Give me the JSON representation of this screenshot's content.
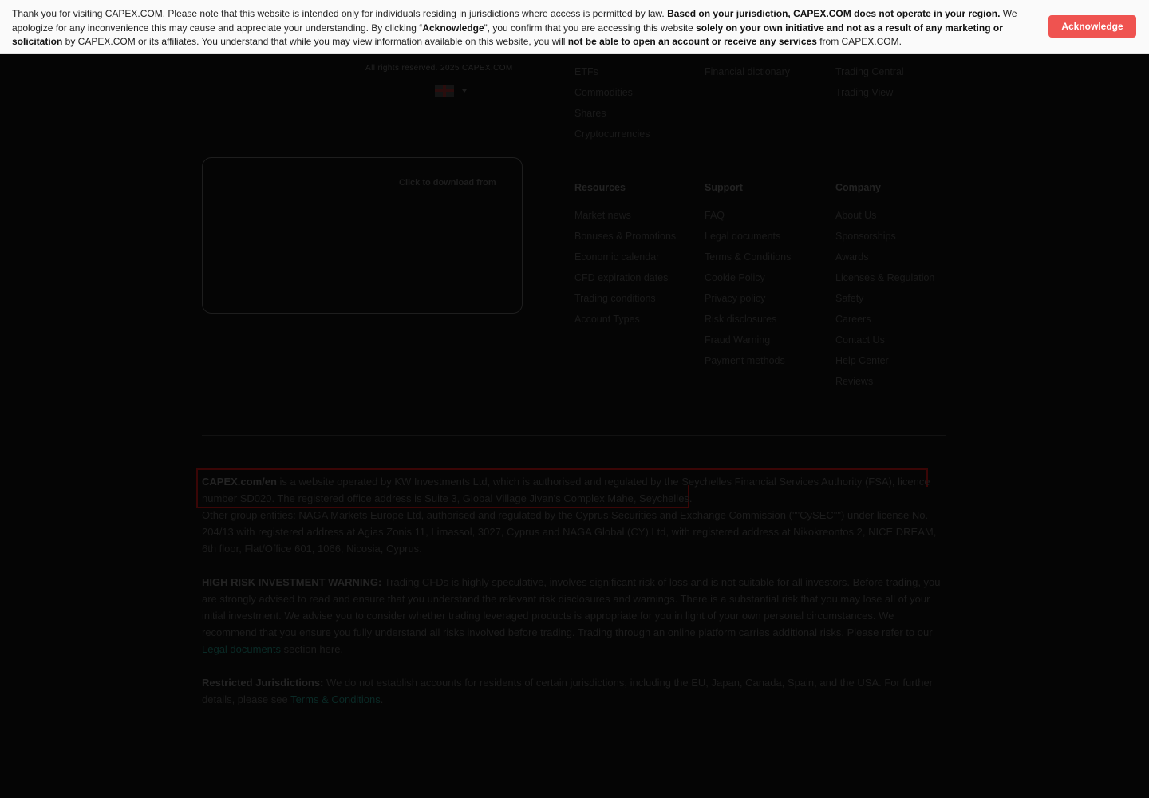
{
  "banner": {
    "p1": "Thank you for visiting CAPEX.COM. Please note that this website is intended only for individuals residing in jurisdictions where access is permitted by law. ",
    "b1": "Based on your jurisdiction, CAPEX.COM does not operate in your region.",
    "p2": " We apologize for any inconvenience this may cause and appreciate your understanding. By clicking “",
    "b2": "Acknowledge",
    "p3": "”, you confirm that you are accessing this website ",
    "b3": "solely on your own initiative and not as a result of any marketing or solicitation",
    "p4": " by CAPEX.COM or its affiliates. You understand that while you may view information available on this website, you will ",
    "b4": "not be able to open an account or receive any services",
    "p5": " from CAPEX.COM.",
    "button_label": "Acknowledge"
  },
  "footer": {
    "rights": "All rights reserved. 2025 CAPEX.COM",
    "download_label": "Click to download from",
    "markets": [
      "ETFs",
      "Commodities",
      "Shares",
      "Cryptocurrencies"
    ],
    "learn": [
      "Financial dictionary"
    ],
    "platforms": [
      "Trading Central",
      "Trading View"
    ],
    "resources": {
      "title": "Resources",
      "items": [
        "Market news",
        "Bonuses & Promotions",
        "Economic calendar",
        "CFD expiration dates",
        "Trading conditions",
        "Account Types"
      ]
    },
    "support": {
      "title": "Support",
      "items": [
        "FAQ",
        "Legal documents",
        "Terms & Conditions",
        "Cookie Policy",
        "Privacy policy",
        "Risk disclosures",
        "Fraud Warning",
        "Payment methods"
      ]
    },
    "company": {
      "title": "Company",
      "items": [
        "About Us",
        "Sponsorships",
        "Awards",
        "Licenses & Regulation",
        "Safety",
        "Careers",
        "Contact Us",
        "Help Center",
        "Reviews"
      ]
    }
  },
  "legal": {
    "site_name": "CAPEX.com/en",
    "operator_text": " is a website operated by KW Investments Ltd, which is authorised and regulated by the Seychelles Financial Services Authority (FSA), licence number SD020. The registered office address is Suite 3, Global Village Jivan's Complex Mahe, Seychelles.",
    "group_text": "Other group entities: NAGA Markets Europe Ltd, authorised and regulated by the Cyprus Securities and Exchange Commission (\"\"CySEC\"\") under license No. 204/13 with registered address at Agias Zonis 11, Limassol, 3027, Cyprus and NAGA Global (CY) Ltd, with registered address at Nikokreontos 2, NICE DREAM, 6th floor, Flat/Office 601, 1066, Nicosia, Cyprus.",
    "warning_title": "HIGH RISK INVESTMENT WARNING:",
    "warning_text": " Trading CFDs is highly speculative, involves significant risk of loss and is not suitable for all investors. Before trading, you are strongly advised to read and ensure that you understand the relevant risk disclosures and warnings. There is a substantial risk that you may lose all of your initial investment. We advise you to consider whether trading leveraged products is appropriate for you in light of your own personal circumstances. We recommend that you ensure you fully understand all risks involved before trading. Trading through an online platform carries additional risks. Please refer to our ",
    "legal_link": "Legal documents",
    "warning_tail": " section here.",
    "restricted_title": "Restricted Jurisdictions:",
    "restricted_text": " We do not establish accounts for residents of certain jurisdictions, including the EU, Japan, Canada, Spain, and the USA. For further details, please see ",
    "terms_link": "Terms & Conditions",
    "restricted_tail": "."
  },
  "colors": {
    "accent": "#ef5350",
    "overlay": "#050505",
    "banner_bg": "#fafafa"
  }
}
